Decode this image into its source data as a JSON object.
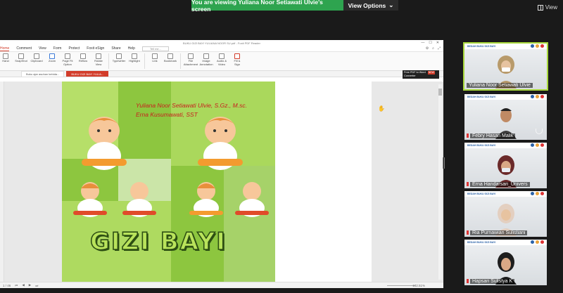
{
  "zoom": {
    "banner_text": "You are viewing Yuliana Noor Setiawati Ulvie's screen",
    "view_options_label": "View Options",
    "view_label": "View"
  },
  "reader": {
    "window_title": "BUKU GIZI BAYI YULIANA NOOR SU.pdf - Foxit PDF Reader",
    "menu": [
      "Home",
      "Comment",
      "View",
      "Form",
      "Protect",
      "Foxit eSign",
      "Share",
      "Help"
    ],
    "tell_me": "Tell me...",
    "ribbon": [
      {
        "label": "Hand",
        "icon": "hand-icon"
      },
      {
        "label": "SnapShot",
        "icon": "camera-icon"
      },
      {
        "label": "Clipboard",
        "icon": "clipboard-icon"
      },
      {
        "label": "Zoom",
        "icon": "zoom-icon"
      },
      {
        "label": "Page Fit Option",
        "icon": "page-fit-icon"
      },
      {
        "label": "Reflow",
        "icon": "reflow-icon"
      },
      {
        "label": "Rotate View",
        "icon": "rotate-icon"
      },
      {
        "label": "Typewriter",
        "icon": "typewriter-icon"
      },
      {
        "label": "Highlight",
        "icon": "highlight-icon"
      },
      {
        "label": "Link",
        "icon": "link-icon"
      },
      {
        "label": "Bookmark",
        "icon": "bookmark-icon"
      },
      {
        "label": "File Attachment",
        "icon": "attachment-icon"
      },
      {
        "label": "Image Annotation",
        "icon": "image-icon"
      },
      {
        "label": "Audio & Video",
        "icon": "video-icon"
      },
      {
        "label": "Fill & Sign",
        "icon": "sign-icon"
      }
    ],
    "converter_line1": "Free PDF to Word",
    "converter_badge": "NEW",
    "converter_line2": "Converter",
    "tabs": [
      "Buku ajar asuhan kebida...",
      "BUKU GIZI BAYI YULIA..."
    ],
    "page_indicator": "1 / 46",
    "zoom_level": "102.51%"
  },
  "cover": {
    "author1": "Yuliana Noor Setiawati Ulvie, S.Gz., M.sc.",
    "author2": "Erna Kusumawati, SST",
    "title": "GIZI BAYI"
  },
  "participants": [
    {
      "name": "Yuliana Noor Setiawati Ulvie",
      "org": "BEDAH BUKU GIZI BAYI",
      "active": true
    },
    {
      "name": "Febry Hasan Malik",
      "org": "BEDAH BUKU GIZI BAYI",
      "active": false
    },
    {
      "name": "Erna Handarsari_Univers",
      "org": "BEDAH BUKU GIZI BAYI",
      "active": false
    },
    {
      "name": "Ria Purnawian Sulistiani",
      "org": "BEDAH BUKU GIZI BAYI",
      "active": false
    },
    {
      "name": "Hapsari Sulistya K",
      "org": "BEDAH BUKU GIZI BAYI",
      "active": false
    }
  ],
  "colors": {
    "banner": "#2ea44f",
    "active_border": "#a8d83c",
    "foxit_accent": "#d23c2a",
    "cover_green": "#8dc63f",
    "author_red": "#c8201e"
  }
}
